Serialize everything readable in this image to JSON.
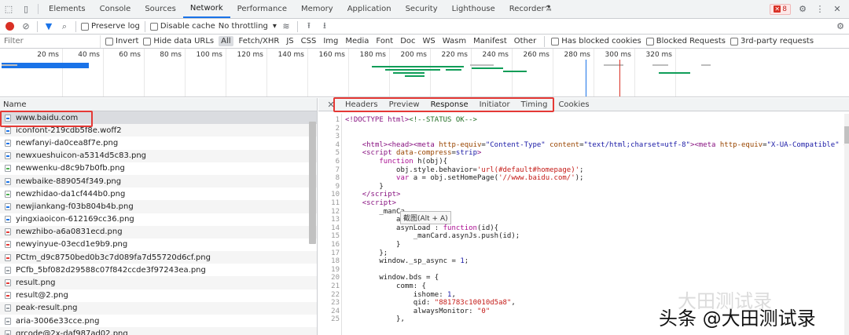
{
  "devtools": {
    "tabs": [
      "Elements",
      "Console",
      "Sources",
      "Network",
      "Performance",
      "Memory",
      "Application",
      "Security",
      "Lighthouse",
      "Recorder"
    ],
    "active_tab": "Network",
    "recorder_icon": "flask-icon",
    "error_count": "8"
  },
  "network_toolbar": {
    "preserve_log": "Preserve log",
    "disable_cache": "Disable cache",
    "throttling": "No throttling"
  },
  "filter_bar": {
    "placeholder": "Filter",
    "invert": "Invert",
    "hide_data_urls": "Hide data URLs",
    "types": [
      "All",
      "Fetch/XHR",
      "JS",
      "CSS",
      "Img",
      "Media",
      "Font",
      "Doc",
      "WS",
      "Wasm",
      "Manifest",
      "Other"
    ],
    "active_type": "All",
    "has_blocked_cookies": "Has blocked cookies",
    "blocked_requests": "Blocked Requests",
    "third_party": "3rd-party requests"
  },
  "overview": {
    "ticks": [
      "20 ms",
      "40 ms",
      "60 ms",
      "80 ms",
      "100 ms",
      "120 ms",
      "140 ms",
      "160 ms",
      "180 ms",
      "200 ms",
      "220 ms",
      "240 ms",
      "260 ms",
      "280 ms",
      "300 ms",
      "320 ms"
    ],
    "colors": {
      "blue": "#1a73e8",
      "green": "#0f9d58",
      "red": "#d93025",
      "grey": "#bdbdbd"
    }
  },
  "request_list": {
    "header": "Name",
    "items": [
      {
        "name": "www.baidu.com",
        "icon": "document-icon",
        "icon_color": "#1a73e8"
      },
      {
        "name": "iconfont-219cdb5f8e.woff2",
        "icon": "font-file-icon",
        "icon_color": "#1a73e8"
      },
      {
        "name": "newfanyi-da0cea8f7e.png",
        "icon": "image-file-icon",
        "icon_color": "#1a73e8"
      },
      {
        "name": "newxueshuicon-a5314d5c83.png",
        "icon": "image-file-icon",
        "icon_color": "#1a73e8"
      },
      {
        "name": "newwenku-d8c9b7b0fb.png",
        "icon": "image-file-icon",
        "icon_color": "#4caf50"
      },
      {
        "name": "newbaike-889054f349.png",
        "icon": "image-file-icon",
        "icon_color": "#1a73e8"
      },
      {
        "name": "newzhidao-da1cf444b0.png",
        "icon": "image-file-icon",
        "icon_color": "#4caf50"
      },
      {
        "name": "newjiankang-f03b804b4b.png",
        "icon": "image-file-icon",
        "icon_color": "#1a73e8"
      },
      {
        "name": "yingxiaoicon-612169cc36.png",
        "icon": "image-file-icon",
        "icon_color": "#1a73e8"
      },
      {
        "name": "newzhibo-a6a0831ecd.png",
        "icon": "image-file-icon",
        "icon_color": "#e53935"
      },
      {
        "name": "newyinyue-03ecd1e9b9.png",
        "icon": "image-file-icon",
        "icon_color": "#e53935"
      },
      {
        "name": "PCtm_d9c8750bed0b3c7d089fa7d55720d6cf.png",
        "icon": "image-file-icon",
        "icon_color": "#e53935"
      },
      {
        "name": "PCfb_5bf082d29588c07f842ccde3f97243ea.png",
        "icon": "image-file-icon",
        "icon_color": "#9aa0a6"
      },
      {
        "name": "result.png",
        "icon": "image-file-icon",
        "icon_color": "#e53935"
      },
      {
        "name": "result@2.png",
        "icon": "image-file-icon",
        "icon_color": "#e53935"
      },
      {
        "name": "peak-result.png",
        "icon": "image-file-icon",
        "icon_color": "#9aa0a6"
      },
      {
        "name": "aria-3006e33cce.png",
        "icon": "image-file-icon",
        "icon_color": "#9aa0a6"
      },
      {
        "name": "qrcode@2x-daf987ad02.png",
        "icon": "image-file-icon",
        "icon_color": "#9aa0a6"
      }
    ],
    "selected_index": 0
  },
  "details": {
    "tabs": [
      "Headers",
      "Preview",
      "Response",
      "Initiator",
      "Timing",
      "Cookies"
    ],
    "active_tab": "Response"
  },
  "tooltip": "截图(Alt + A)",
  "watermark": {
    "top_line": "大田测试录",
    "main_line": "头条 @大田测试录"
  }
}
